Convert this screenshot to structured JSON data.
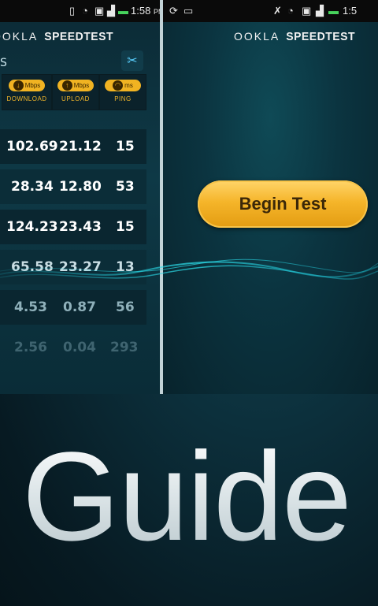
{
  "left": {
    "status": {
      "time": "1:58",
      "ampm": "PM"
    },
    "brand": {
      "logo": "OOKLA",
      "name": "SPEEDTEST"
    },
    "header_fragment": "S",
    "columns": [
      {
        "unit": "Mbps",
        "label": "DOWNLOAD",
        "icon": "arrow-down-icon"
      },
      {
        "unit": "Mbps",
        "label": "UPLOAD",
        "icon": "arrow-up-icon"
      },
      {
        "unit": "ms",
        "label": "PING",
        "icon": "gauge-icon"
      }
    ],
    "results": [
      {
        "download": "102.69",
        "upload": "21.12",
        "ping": "15"
      },
      {
        "download": "28.34",
        "upload": "12.80",
        "ping": "53"
      },
      {
        "download": "124.23",
        "upload": "23.43",
        "ping": "15"
      },
      {
        "download": "65.58",
        "upload": "23.27",
        "ping": "13"
      },
      {
        "download": "4.53",
        "upload": "0.87",
        "ping": "56"
      },
      {
        "download": "2.56",
        "upload": "0.04",
        "ping": "293"
      }
    ]
  },
  "right": {
    "status": {
      "time": "1:5"
    },
    "brand": {
      "logo": "OOKLA",
      "name": "SPEEDTEST"
    },
    "begin_button": "Begin Test"
  },
  "overlay_title": "Guide",
  "colors": {
    "accent": "#f5b52a",
    "background": "#0c2f3b",
    "tools": "#5ad0ff"
  }
}
